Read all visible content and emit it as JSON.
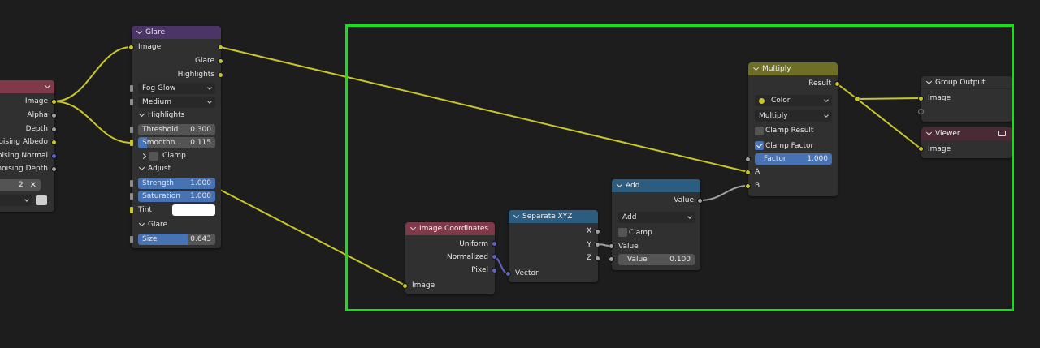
{
  "colors": {
    "frame": "#17e017",
    "wire_yellow": "#c7c729",
    "wire_gray": "#a1a1a1",
    "wire_purple": "#6363c7",
    "header_filter": "#4a3566",
    "header_converter": "#6e6e25",
    "header_vector": "#2c5d80",
    "header_input": "#7f3a4a"
  },
  "render_layers": {
    "outputs": [
      "Image",
      "Alpha",
      "Depth",
      "noising Albedo",
      "noising Normal",
      "enoising Depth"
    ],
    "field_value": "2"
  },
  "glare": {
    "title": "Glare",
    "input_image": "Image",
    "outputs": [
      "Glare",
      "Highlights"
    ],
    "glare_type": "Fog Glow",
    "quality": "Medium",
    "highlights_section": "Highlights",
    "threshold_label": "Threshold",
    "threshold_value": "0.300",
    "smoothness_label": "Smoothn...",
    "smoothness_value": "0.115",
    "smoothness_fill": 0.115,
    "clamp_label": "Clamp",
    "adjust_section": "Adjust",
    "strength_label": "Strength",
    "strength_value": "1.000",
    "saturation_label": "Saturation",
    "saturation_value": "1.000",
    "tint_label": "Tint",
    "glare_section": "Glare",
    "size_label": "Size",
    "size_value": "0.643",
    "size_fill": 0.643
  },
  "multiply": {
    "title": "Multiply",
    "output": "Result",
    "data_type": "Color",
    "blend_mode": "Multiply",
    "clamp_result": "Clamp Result",
    "clamp_factor": "Clamp Factor",
    "factor_label": "Factor",
    "factor_value": "1.000",
    "input_a": "A",
    "input_b": "B"
  },
  "group_output": {
    "title": "Group Output",
    "input": "Image"
  },
  "viewer": {
    "title": "Viewer",
    "input": "Image"
  },
  "add": {
    "title": "Add",
    "output": "Value",
    "operation": "Add",
    "clamp": "Clamp",
    "input_value": "Value",
    "value_label": "Value",
    "value_value": "0.100"
  },
  "separate_xyz": {
    "title": "Separate XYZ",
    "outputs": [
      "X",
      "Y",
      "Z"
    ],
    "input": "Vector"
  },
  "image_coordinates": {
    "title": "Image Coordinates",
    "outputs": [
      "Uniform",
      "Normalized",
      "Pixel"
    ],
    "input": "Image"
  }
}
